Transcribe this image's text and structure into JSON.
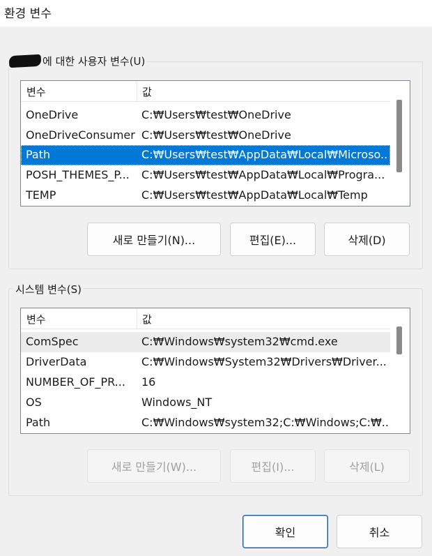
{
  "window": {
    "title": "환경 변수"
  },
  "user_vars": {
    "group_label": "에 대한 사용자 변수(U)",
    "columns": [
      "변수",
      "값"
    ],
    "rows": [
      {
        "name": "OneDrive",
        "value": "C:₩Users₩test₩OneDrive"
      },
      {
        "name": "OneDriveConsumer",
        "value": "C:₩Users₩test₩OneDrive"
      },
      {
        "name": "Path",
        "value": "C:₩Users₩test₩AppData₩Local₩Microso..."
      },
      {
        "name": "POSH_THEMES_P...",
        "value": "C:₩Users₩test₩AppData₩Local₩Progra..."
      },
      {
        "name": "TEMP",
        "value": "C:₩Users₩test₩AppData₩Local₩Temp"
      }
    ],
    "selected_row": "Path",
    "buttons": {
      "new": "새로 만들기(N)...",
      "edit": "편집(E)...",
      "delete": "삭제(D)"
    }
  },
  "system_vars": {
    "group_label": "시스템 변수(S)",
    "columns": [
      "변수",
      "값"
    ],
    "rows": [
      {
        "name": "ComSpec",
        "value": "C:₩Windows₩system32₩cmd.exe"
      },
      {
        "name": "DriverData",
        "value": "C:₩Windows₩System32₩Drivers₩Driver..."
      },
      {
        "name": "NUMBER_OF_PR...",
        "value": "16"
      },
      {
        "name": "OS",
        "value": "Windows_NT"
      },
      {
        "name": "Path",
        "value": "C:₩Windows₩system32;C:₩Windows;C:₩..."
      }
    ],
    "buttons": {
      "new": "새로 만들기(W)...",
      "edit": "편집(I)...",
      "delete": "삭제(L)"
    }
  },
  "footer": {
    "ok": "확인",
    "cancel": "취소"
  },
  "colors": {
    "selection": "#0078d7",
    "primary_border": "#1a5fa8"
  }
}
